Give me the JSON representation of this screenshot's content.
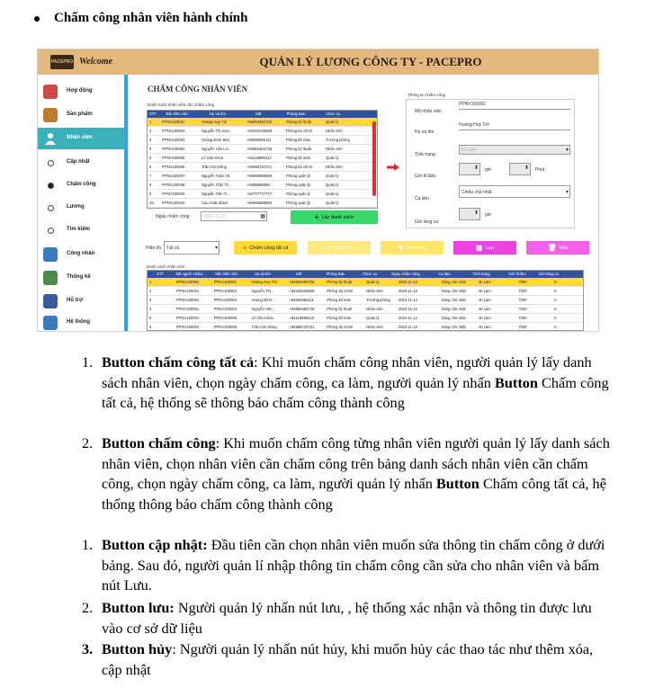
{
  "heading": "Chấm công nhân viên hành chính",
  "app": {
    "logo_text": "PACEPRO",
    "welcome": "Welcome",
    "title": "QUẢN LÝ LƯƠNG CÔNG TY - PACEPRO",
    "sidebar": [
      {
        "label": "Hợp đồng",
        "icon": "contract-icon",
        "color": "#d04a4a"
      },
      {
        "label": "Sản phẩm",
        "icon": "product-icon",
        "color": "#c07a30"
      },
      {
        "label": "Nhân viên",
        "icon": "employee-icon",
        "color": "#ffffff",
        "active": true
      },
      {
        "label": "Cập nhật",
        "sub": true
      },
      {
        "label": "Chấm công",
        "sub": true,
        "filled": true
      },
      {
        "label": "Lương",
        "sub": true
      },
      {
        "label": "Tìm kiếm",
        "sub": true
      },
      {
        "label": "Công nhân",
        "icon": "worker-icon",
        "color": "#3a7abf"
      },
      {
        "label": "Thống kê",
        "icon": "stats-icon",
        "color": "#4a8a4a"
      },
      {
        "label": "Hỗ trợ",
        "icon": "support-icon",
        "color": "#3a5a9a"
      },
      {
        "label": "Hệ thống",
        "icon": "system-icon",
        "color": "#3a7abf"
      }
    ],
    "page_title": "CHẤM CÔNG NHÂN VIÊN",
    "employee_list_label": "Danh sách nhân viên cần chấm công",
    "employee_columns": [
      "STT",
      "Mã nhân viên",
      "Họ và tên",
      "Sđt",
      "Phòng Ban",
      "Chức vụ"
    ],
    "employee_rows": [
      [
        "1",
        "PPNV100001",
        "Hoàng Huy Tới",
        "+84983484725",
        "Phòng kỹ thuật",
        "Quản lý"
      ],
      [
        "2",
        "PPNV100002",
        "Nguyễn Thị Hươ...",
        "+84325230839",
        "Phòng tài chính",
        "Nhân viên"
      ],
      [
        "3",
        "PPNV100003",
        "Hoàng Đình Bảo",
        "+84555555111",
        "Phòng kế toán",
        "Trưởng phòng"
      ],
      [
        "4",
        "PPNV100004",
        "Nguyễn Văn Lin...",
        "+84983484728",
        "Phòng kỹ thuật",
        "Nhân viên"
      ],
      [
        "5",
        "PPNV100005",
        "Lê Văn Khoa",
        "+84119999222",
        "Phòng kế toán",
        "Quản lý"
      ],
      [
        "6",
        "PPNV100006",
        "Trần Anh Dũng",
        "+84985722721",
        "Phòng tài chính",
        "Nhân viên"
      ],
      [
        "7",
        "PPNV100007",
        "Nguyễn Tuấn Vũ",
        "+84999999999",
        "Phòng quản lý",
        "Quản lý"
      ],
      [
        "8",
        "PPNV100008",
        "Nguyễn Trần Th...",
        "+8488888888",
        "Phòng quản lý",
        "Quản lý"
      ],
      [
        "9",
        "PPNV100009",
        "Nguyễn Tiến Tr...",
        "+84777777777",
        "Phòng quản lý",
        "Quản lý"
      ],
      [
        "10",
        "PPNV100010",
        "Cao Xuân Bách",
        "+84666666666",
        "Phòng quản lý",
        "Quản lý"
      ]
    ],
    "date_label": "Ngày chấm công",
    "date_value": "2023-11-12",
    "get_list_button": "Lấy danh sách",
    "info_panel_title": "Thông tin chấm công",
    "fields": {
      "emp_id_label": "Mã nhân viên",
      "emp_id_value": "PPNV100001",
      "name_label": "Họ và tên",
      "name_value": "Hoàng Huy Tới",
      "status_label": "Tình trạng",
      "status_value": "Đi Làm",
      "checkin_label": "Giờ đi làm",
      "hour_label": "giờ",
      "minute_label": "Phút",
      "shift_label": "Ca làm",
      "shift_value": "Chiều chủ nhật",
      "ot_label": "Giờ tăng ca",
      "ot_hour_label": "giờ"
    },
    "filter_label": "Hiển thị",
    "filter_value": "Tất cả",
    "actions": {
      "check_all": "Chấm công tất cả",
      "check": "Chấm lạ",
      "update": "Cập nhật",
      "save": "Lưu",
      "cancel": "Hủy"
    },
    "colors": {
      "check_all": "#ffd83a",
      "check": "#ffe880",
      "update": "#ffe566",
      "save": "#f040e0",
      "cancel": "#f060e8",
      "get_list": "#36d86a"
    },
    "attendance_label": "Danh sách nhân viên",
    "attendance_columns": [
      "STT",
      "Mã người chấm...",
      "Mã nhân viên",
      "Họ và tên",
      "Sđt",
      "Phòng Ban",
      "Chức vụ",
      "Ngày chấm công",
      "Ca làm",
      "Tình trạng",
      "Giờ đi làm",
      "Giờ tăng ca"
    ],
    "attendance_rows": [
      [
        "1",
        "PPNV100001",
        "PPNV100001",
        "Hoàng Huy Tới",
        "+84983484725",
        "Phòng kỹ thuật",
        "Quản lý",
        "2023-11-12",
        "Sáng chủ nhật",
        "Đi Làm",
        "7h00",
        "0"
      ],
      [
        "2",
        "PPNV100001",
        "PPNV100002",
        "Nguyễn Thị ...",
        "+84325230839",
        "Phòng tài chính",
        "Nhân viên",
        "2023-11-12",
        "Sáng chủ nhật",
        "Đi Làm",
        "7h00",
        "0"
      ],
      [
        "3",
        "PPNV100001",
        "PPNV100003",
        "Hoàng Đình...",
        "+84555555111",
        "Phòng kế toán",
        "Trưởng phòng",
        "2023-11-12",
        "Sáng chủ nhật",
        "Đi Làm",
        "7h00",
        "0"
      ],
      [
        "4",
        "PPNV100001",
        "PPNV100004",
        "Nguyễn Văn ...",
        "+84983484728",
        "Phòng kỹ thuật",
        "Nhân viên",
        "2023-11-12",
        "Sáng chủ nhật",
        "Đi Làm",
        "7h00",
        "0"
      ],
      [
        "5",
        "PPNV100001",
        "PPNV100005",
        "Lê Văn Khoa",
        "+84119999222",
        "Phòng kế toán",
        "Quản lý",
        "2023-11-12",
        "Sáng chủ nhật",
        "Đi Làm",
        "7h00",
        "0"
      ],
      [
        "6",
        "PPNV100001",
        "PPNV100006",
        "Trần Anh Dũng",
        "+84985722721",
        "Phòng tài chính",
        "Nhân viên",
        "2023-11-12",
        "Sáng chủ nhật",
        "Đi Làm",
        "7h00",
        "0"
      ]
    ]
  },
  "instructions": [
    {
      "num": "1.",
      "bold": "Button chấm công tất cả",
      "rest": ": Khi muốn chấm công nhân viên, người quản lý lấy danh sách nhân viên, chọn ngày chấm công, ca làm, người quản lý nhấn ",
      "bold2": "Button",
      "rest2": " Chấm công tất cả, hệ thống sẽ thông báo chấm công thành công"
    },
    {
      "num": "2.",
      "bold": "Button chấm công",
      "rest": ": Khi muốn chấm công từng nhân viên người quản lý lấy danh sách nhân viên, chọn nhân viên cần chấm công trên bảng danh sách nhân viên cần chấm công, chọn ngày chấm công, ca làm, người quản lý nhấn ",
      "bold2": "Button",
      "rest2": " Chấm công tất cả, hệ thống thông báo chấm công thành công"
    },
    {
      "num": "1.",
      "bold": "Button cập nhật:",
      "rest": " Đầu tiên cần chọn nhân viên muốn sửa thông tin chấm công ở dưới bảng. Sau đó, người quản lí nhập thông tin chấm công cần sửa cho nhân viên và bấm nút Lưu.",
      "bold2": "",
      "rest2": ""
    },
    {
      "num": "2.",
      "bold": "Button lưu:",
      "rest": " Người quản lý nhấn nút lưu, , hệ thống xác nhận và thông tin được lưu vào cơ sở dữ liệu",
      "bold2": "",
      "rest2": ""
    },
    {
      "num": "3.",
      "bold": "Button hủy",
      "rest": ": Người quản lý nhấn nút hủy, khi muốn hủy các thao tác như thêm xóa, cập  nhật",
      "bold2": "",
      "rest2": "",
      "num_bold": true
    }
  ]
}
